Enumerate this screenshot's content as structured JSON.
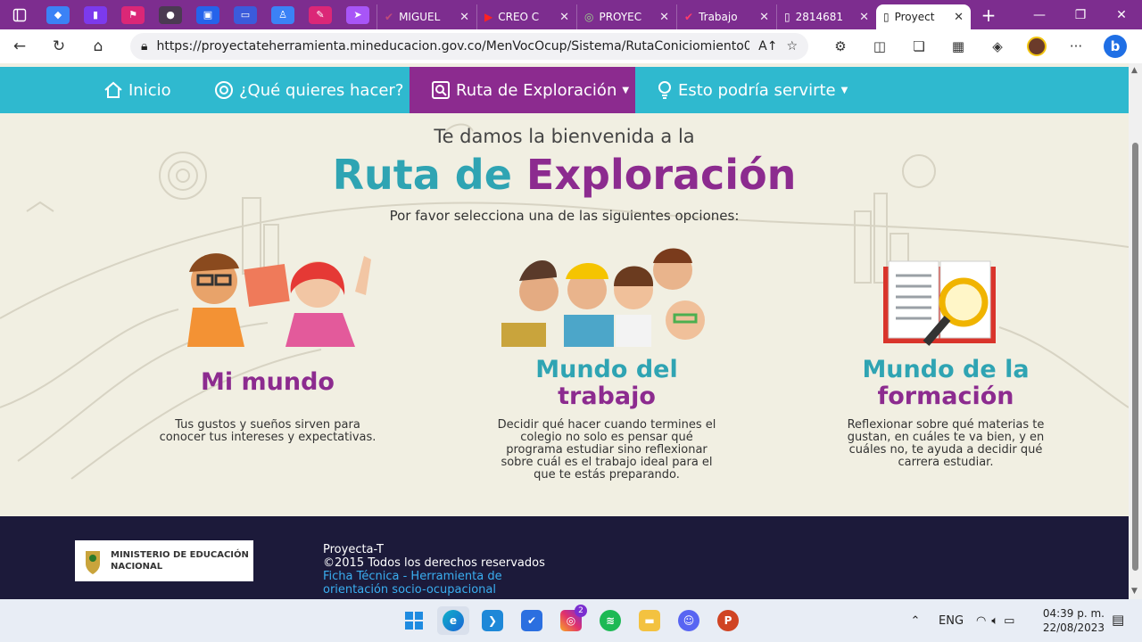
{
  "browser": {
    "tabs": [
      {
        "label": "MIGUEL",
        "icon": "check-icon"
      },
      {
        "label": "CREO C",
        "icon": "youtube-icon"
      },
      {
        "label": "PROYEC",
        "icon": "crest-icon"
      },
      {
        "label": "Trabajo",
        "icon": "check-icon"
      },
      {
        "label": "2814681",
        "icon": "document-icon"
      },
      {
        "label": "Proyect",
        "icon": "page-icon"
      }
    ],
    "url": "https://proyectateherramienta.mineducacion.gov.co/MenVocOcup/Sistema/RutaConiciomiento0-00....",
    "read_aloud_glyph": "A↑"
  },
  "nav": {
    "items": [
      {
        "label": "Inicio",
        "icon": "home-icon"
      },
      {
        "label": "¿Qué quieres hacer?",
        "icon": "target-icon"
      },
      {
        "label": "Ruta de Exploración",
        "icon": "search-doc-icon",
        "dropdown": true,
        "active": true
      },
      {
        "label": "Esto podría servirte",
        "icon": "lightbulb-icon",
        "dropdown": true
      }
    ]
  },
  "hero": {
    "pre_title": "Te damos la bienvenida a la",
    "title_part1": "Ruta de",
    "title_part2": "Exploración",
    "subtitle": "Por favor selecciona una de las siguientes opciones:"
  },
  "cards": [
    {
      "title_line1": "Mi mundo",
      "title_line2": "",
      "description": "Tus gustos y sueños sirven para conocer tus intereses y expectativas."
    },
    {
      "title_line1": "Mundo del",
      "title_line2": "trabajo",
      "description": "Decidir qué hacer cuando termines el colegio no solo es pensar qué programa estudiar sino reflexionar sobre cuál es el trabajo ideal para el que te estás preparando."
    },
    {
      "title_line1": "Mundo de la",
      "title_line2": "formación",
      "description": "Reflexionar sobre qué materias te gustan, en cuáles te va bien, y en cuáles no, te ayuda a decidir qué carrera estudiar."
    }
  ],
  "footer": {
    "logo_text_line1": "MINISTERIO DE EDUCACIÓN",
    "logo_text_line2": "NACIONAL",
    "app_name": "Proyecta-T",
    "copyright": "©2015 Todos los derechos reservados",
    "link_line1": "Ficha Técnica - Herramienta de",
    "link_line2": "orientación socio-ocupacional"
  },
  "taskbar": {
    "language": "ENG",
    "time": "04:39 p. m.",
    "date": "22/08/2023",
    "instagram_badge": "2"
  },
  "colors": {
    "purple": "#8c2b8f",
    "teal": "#2fa4b3",
    "nav_bg": "#2fb9cf",
    "footer_bg": "#1c1a3a",
    "page_bg": "#f1efe2"
  }
}
